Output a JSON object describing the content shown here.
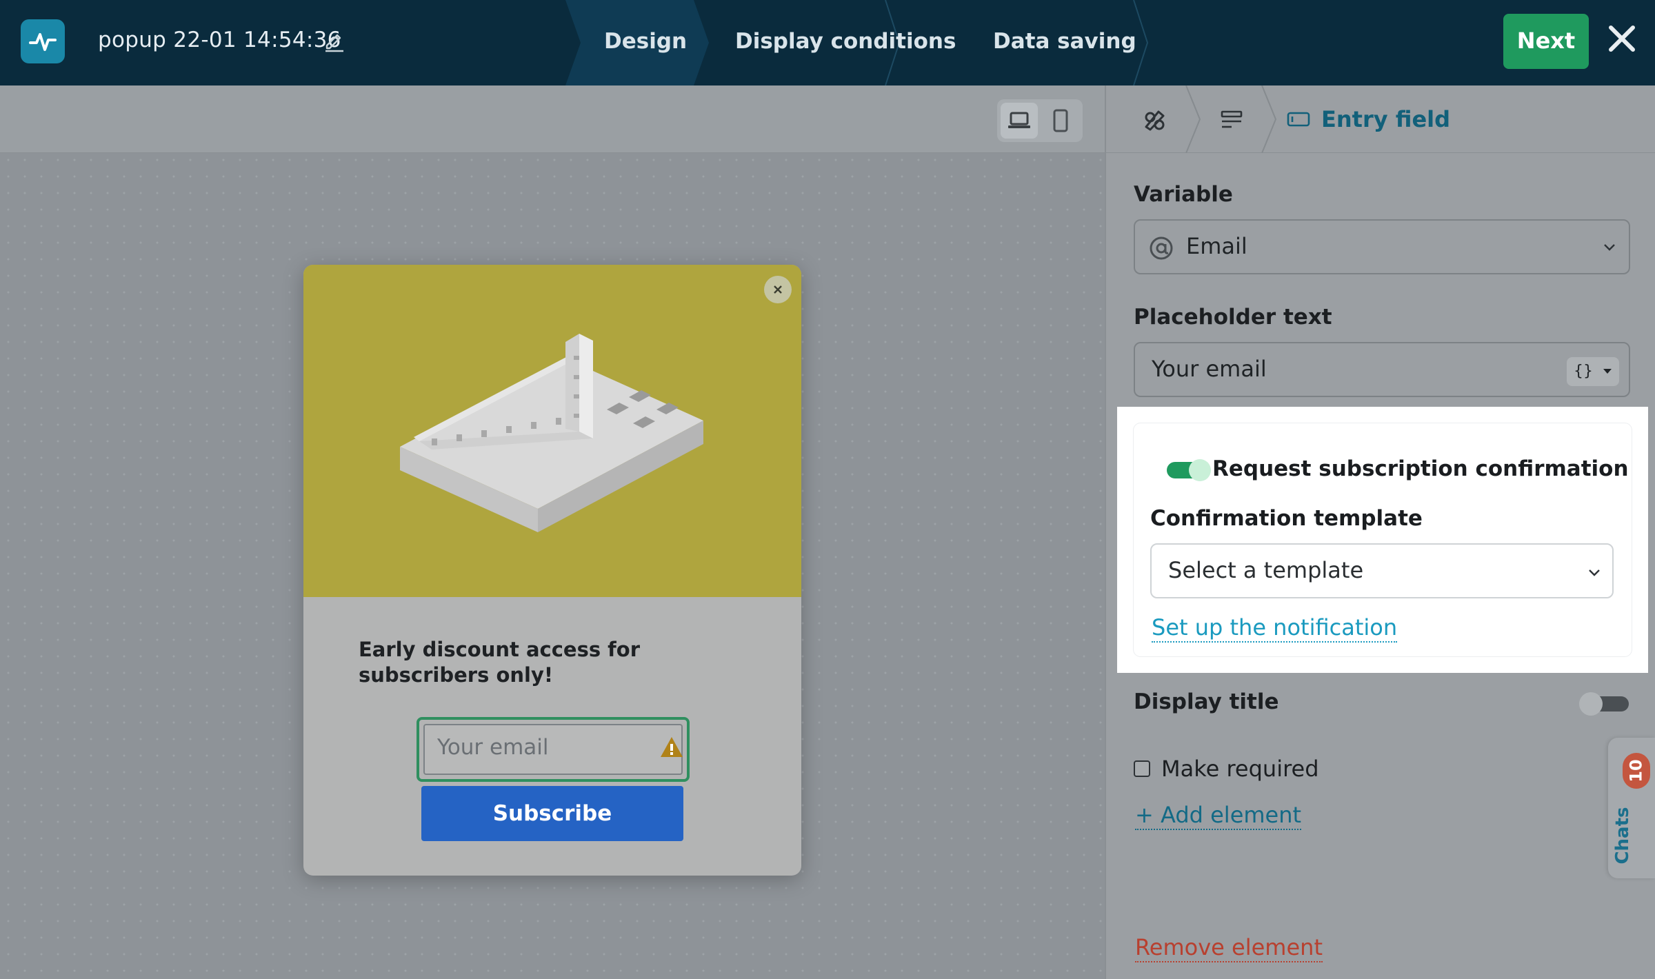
{
  "header": {
    "doc_title": "popup 22-01 14:54:36",
    "steps": [
      {
        "label": "Design",
        "active": true
      },
      {
        "label": "Display conditions",
        "active": false
      },
      {
        "label": "Data saving",
        "active": false
      }
    ],
    "next_label": "Next"
  },
  "canvas": {
    "device_modes": [
      "desktop",
      "mobile"
    ],
    "active_device": "desktop"
  },
  "popup": {
    "heading": "Early discount access for subscribers only!",
    "input_placeholder": "Your email",
    "subscribe_label": "Subscribe"
  },
  "panel": {
    "tabs": {
      "active_label": "Entry field"
    },
    "variable": {
      "label": "Variable",
      "value": "Email"
    },
    "placeholder": {
      "label": "Placeholder text",
      "value": "Your email",
      "vars_button": "{}"
    },
    "confirmation": {
      "toggle_label": "Request subscription confirmation",
      "toggle_on": true,
      "template_label": "Confirmation template",
      "template_value": "Select a template",
      "notification_link": "Set up the notification"
    },
    "display_title": {
      "label": "Display title",
      "on": false
    },
    "make_required": {
      "label": "Make required",
      "checked": false
    },
    "add_element": "+ Add element",
    "remove_element": "Remove element"
  },
  "chats": {
    "label": "Chats",
    "count": "10"
  },
  "colors": {
    "topbar": "#0a2b3d",
    "accent_green": "#1f9a5e",
    "link_blue": "#1a9abf",
    "subscribe_blue": "#2563c4",
    "danger": "#b8402f",
    "hero_yellow": "#afa53e"
  }
}
